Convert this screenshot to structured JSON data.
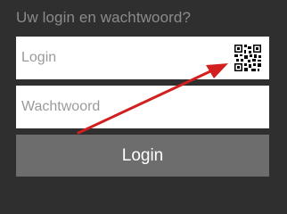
{
  "form": {
    "title": "Uw login en wachtwoord?",
    "login": {
      "placeholder": "Login",
      "value": ""
    },
    "password": {
      "placeholder": "Wachtwoord",
      "value": ""
    },
    "submit_label": "Login"
  },
  "icons": {
    "qr": "qr-code-icon",
    "annotation": "arrow-annotation"
  },
  "colors": {
    "background": "#2f2f2f",
    "title_text": "#8b8b8b",
    "field_bg": "#ffffff",
    "placeholder": "#9a9a9a",
    "button_bg": "#6d6d6d",
    "button_text": "#ffffff",
    "arrow": "#d21f1f"
  }
}
